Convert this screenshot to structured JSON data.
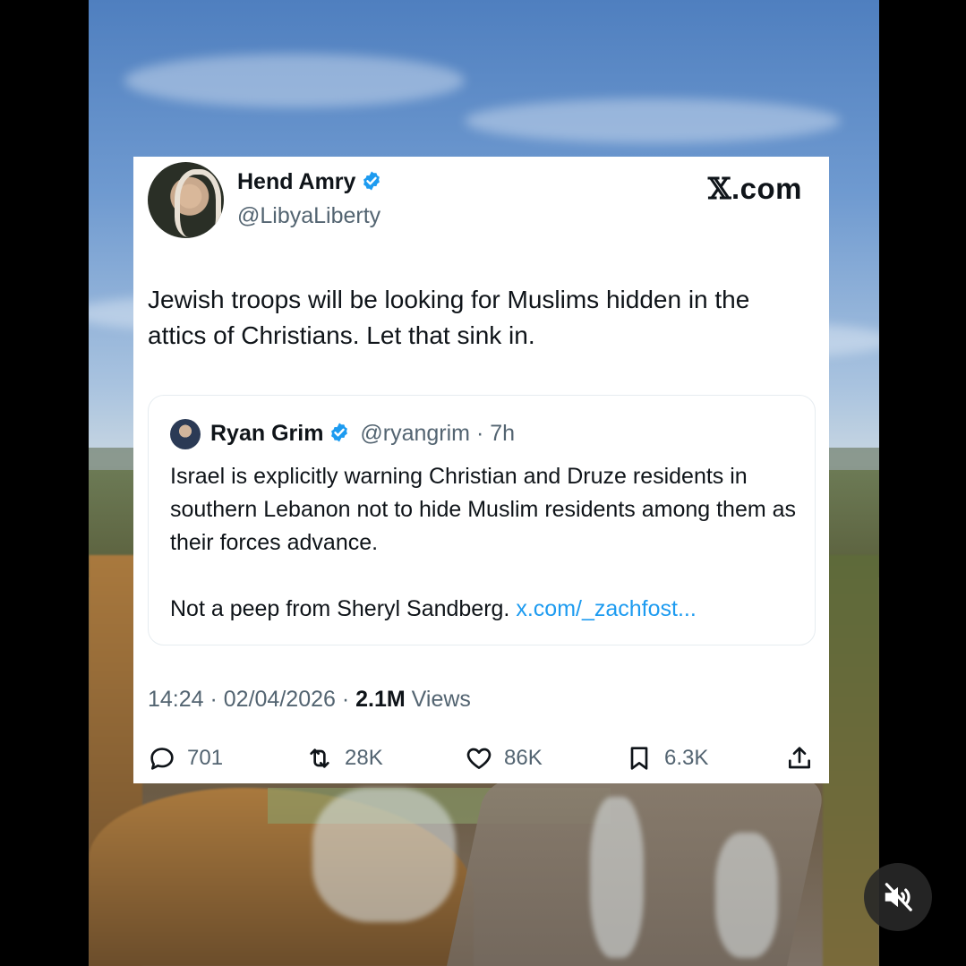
{
  "author": {
    "name": "Hend Amry",
    "handle": "@LibyaLiberty"
  },
  "brand": {
    "x_glyph": "𝕏",
    "domain": ".com"
  },
  "tweet_text": "Jewish troops will be looking for Muslims hidden in the attics of Christians. Let that sink in.",
  "quoted": {
    "name": "Ryan Grim",
    "handle_time": "@ryangrim · 7h",
    "paragraph1": "Israel is explicitly warning Christian and Druze residents in southern Lebanon not to hide Muslim residents among them as their forces advance.",
    "paragraph2": "Not a peep from Sheryl Sandberg.",
    "link": "x.com/_zachfost..."
  },
  "timestamp": "14:24 · 02/04/2026 · ",
  "views_count": "2.1M",
  "views_label": " Views",
  "actions": {
    "replies": "701",
    "reposts": "28K",
    "likes": "86K",
    "bookmarks": "6.3K"
  },
  "colors": {
    "verified": "#1d9bf0",
    "link": "#1d9bf0",
    "secondary_text": "#536471"
  }
}
